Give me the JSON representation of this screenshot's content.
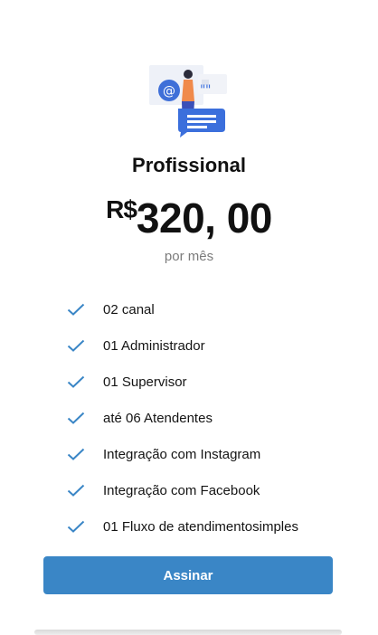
{
  "plan": {
    "title": "Profissional",
    "currency": "R$",
    "price": "320, 00",
    "period": "por mês"
  },
  "features": [
    "02 canal",
    "01 Administrador",
    "01 Supervisor",
    "até 06 Atendentes",
    "Integração com Instagram",
    "Integração com Facebook",
    "01 Fluxo de atendimentosimples"
  ],
  "icons": {
    "illustration": "support-agent-chat-illustration",
    "feature_check": "check-icon"
  },
  "button": {
    "label": "Assinar"
  },
  "colors": {
    "accent": "#3a86c6",
    "check": "#3a86c6",
    "period_text": "#7b7b7b"
  }
}
